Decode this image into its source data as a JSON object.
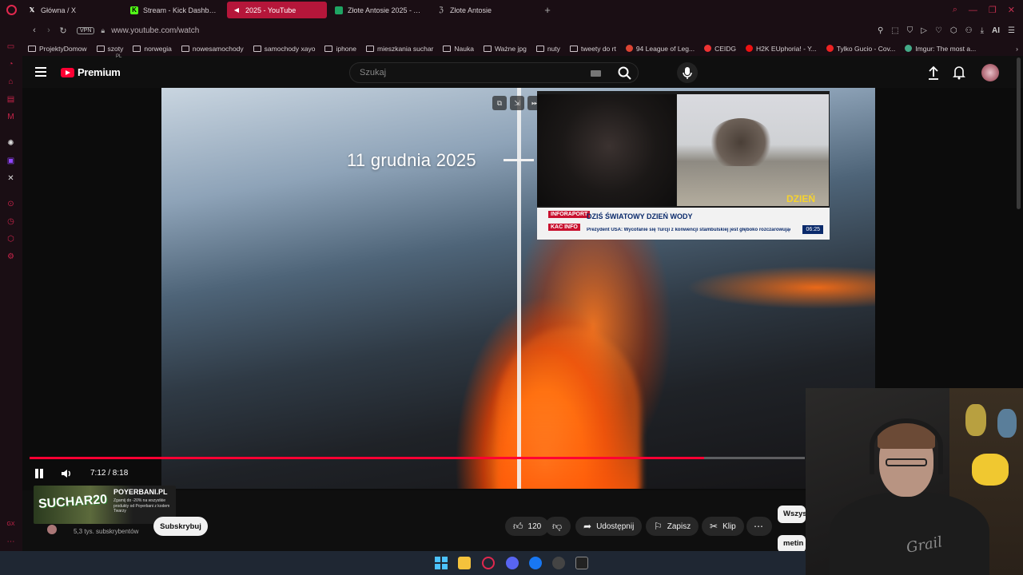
{
  "browser": {
    "tabs": [
      {
        "label": "Główna / X",
        "icon": "x-icon"
      },
      {
        "label": "Stream - Kick Dashboard",
        "icon": "kick-icon"
      },
      {
        "label": "2025 - YouTube",
        "icon": "youtube-icon",
        "active": true
      },
      {
        "label": "Złote Antosie 2025 - Arku",
        "icon": "sheets-icon"
      },
      {
        "label": "Złote Antosie",
        "icon": "doc-icon"
      }
    ],
    "url": "www.youtube.com/watch",
    "vpn_label": "VPN",
    "ai_label": "AI",
    "bookmarks": [
      {
        "label": "ProjektyDomow",
        "type": "folder"
      },
      {
        "label": "szoty",
        "type": "folder"
      },
      {
        "label": "norwegia",
        "type": "folder"
      },
      {
        "label": "nowesamochody",
        "type": "folder"
      },
      {
        "label": "samochody xayo",
        "type": "folder"
      },
      {
        "label": "iphone",
        "type": "folder"
      },
      {
        "label": "mieszkania suchar",
        "type": "folder"
      },
      {
        "label": "Nauka",
        "type": "folder"
      },
      {
        "label": "Ważne jpg",
        "type": "folder"
      },
      {
        "label": "nuty",
        "type": "folder"
      },
      {
        "label": "tweety do rt",
        "type": "folder"
      },
      {
        "label": "94 League of Leg...",
        "type": "site"
      },
      {
        "label": "CEIDG",
        "type": "site"
      },
      {
        "label": "H2K EUphoria! - Y...",
        "type": "site"
      },
      {
        "label": "Tylko Gucio - Cov...",
        "type": "site"
      },
      {
        "label": "Imgur: The most a...",
        "type": "site"
      }
    ],
    "colors": {
      "accent": "#e0284e",
      "active_tab": "#b5163a"
    }
  },
  "youtube": {
    "logo_text": "Premium",
    "region": "PL",
    "search_placeholder": "Szukaj",
    "colors": {
      "brand": "#ff0033"
    }
  },
  "video": {
    "overlay_date": "11 grudnia 2025",
    "time_display": "7:12 / 8:18",
    "progress_percent": 87,
    "news": {
      "channel_tag": "INFORAPORT",
      "channel_tag2": "KAC INFO",
      "headline": "DZIŚ ŚWIATOWY DZIEŃ WODY",
      "ticker": "Prezydent USA: Wycofanie się Turcji z konwencji stambulskiej jest głęboko rozczarowujące",
      "time": "06:25",
      "brand": "DZIEŃ"
    }
  },
  "below_video": {
    "promo": {
      "code": "SUCHAR20",
      "domain": "POYERBANI.PL",
      "tagline": "Zgarnij do -20% na wszystkie produkty od Poyerbani z kodem Twarzy"
    },
    "subscriber_count": "5,3 tys. subskrybentów",
    "subscribe_label": "Subskrybuj",
    "like_count": "120",
    "share_label": "Udostępnij",
    "save_label": "Zapisz",
    "clip_label": "Klip",
    "chip_all": "Wszys",
    "chip_second": "metin"
  },
  "webcam": {
    "shirt_text": "Grail"
  }
}
